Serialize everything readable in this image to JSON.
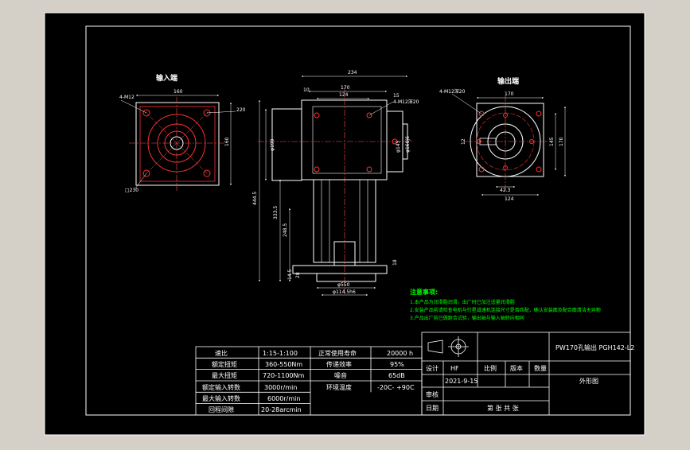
{
  "colors": {
    "frame_bg": "#d4d0c8",
    "canvas_bg": "#000000",
    "line": "#ffffff",
    "part_red": "#ff3030",
    "centerline_red": "#ff5050",
    "note_green": "#00ff00"
  },
  "views": {
    "input_end": {
      "title": "输入端",
      "dim_top": "160",
      "dim_right": "160",
      "callout_holes": "4-M12",
      "callout_diag": "220",
      "callout_bolt": "□230"
    },
    "front": {
      "dims": {
        "overall_w": "234",
        "w170": "170",
        "w124": "124",
        "left_10": "10",
        "right_15": "15",
        "holes": "4-M12深20",
        "d_left": "φ190",
        "d_right_1": "φ160j6",
        "d_right_2": "φ145",
        "h_total": "444.5",
        "h_mid": "333.5",
        "h_low": "248.5",
        "h_base": "28",
        "h_flange": "14.5",
        "bottom_1": "φ550",
        "bottom_2": "φ114.5h6",
        "side_18": "18"
      }
    },
    "output_end": {
      "title": "输出端",
      "dim_top": "170",
      "dim_bottom": "124",
      "dim_key": "42.3",
      "dim_side": "12",
      "callout_holes": "4-M12深20",
      "dim_r1": "145",
      "dim_r2": "170"
    }
  },
  "notes": {
    "title": "注意事项:",
    "items": [
      "1.本产品为润滑脂润滑，出厂时已加注适量润滑脂",
      "2.安装产品前请检查电机与行星减速机连接尺寸是否匹配，确认安装面及配合面清洁无异物",
      "3.产品出厂前已做跑合试验，输出轴与输入轴转向相同"
    ]
  },
  "spec_table": {
    "rows": [
      {
        "label": "速比",
        "value": "1:15-1:100",
        "label2": "正常使用寿命",
        "value2": "20000 h"
      },
      {
        "label": "额定扭矩",
        "value": "360-550Nm",
        "label2": "传递效率",
        "value2": "95%"
      },
      {
        "label": "最大扭矩",
        "value": "720-1100Nm",
        "label2": "噪音",
        "value2": "65dB"
      },
      {
        "label": "额定输入转数",
        "value": "3000r/min",
        "label2": "环境温度",
        "value2": "-20C- +90C"
      },
      {
        "label": "最大输入转数",
        "value": "6000r/min",
        "label2": "",
        "value2": ""
      },
      {
        "label": "回程间隙",
        "value": "20-28arcmin",
        "label2": "",
        "value2": ""
      }
    ]
  },
  "title_block": {
    "title": "PW170孔输出 PGH142-L2",
    "drawing_name": "外形图",
    "design_label": "设计",
    "design_value": "HF",
    "date_value": "2021-9-15",
    "ratio_label": "比例",
    "version_label": "版本",
    "qty_label": "数量",
    "review_label": "审核",
    "date_label": "日期",
    "sheet_text": "第  张  共  张"
  }
}
